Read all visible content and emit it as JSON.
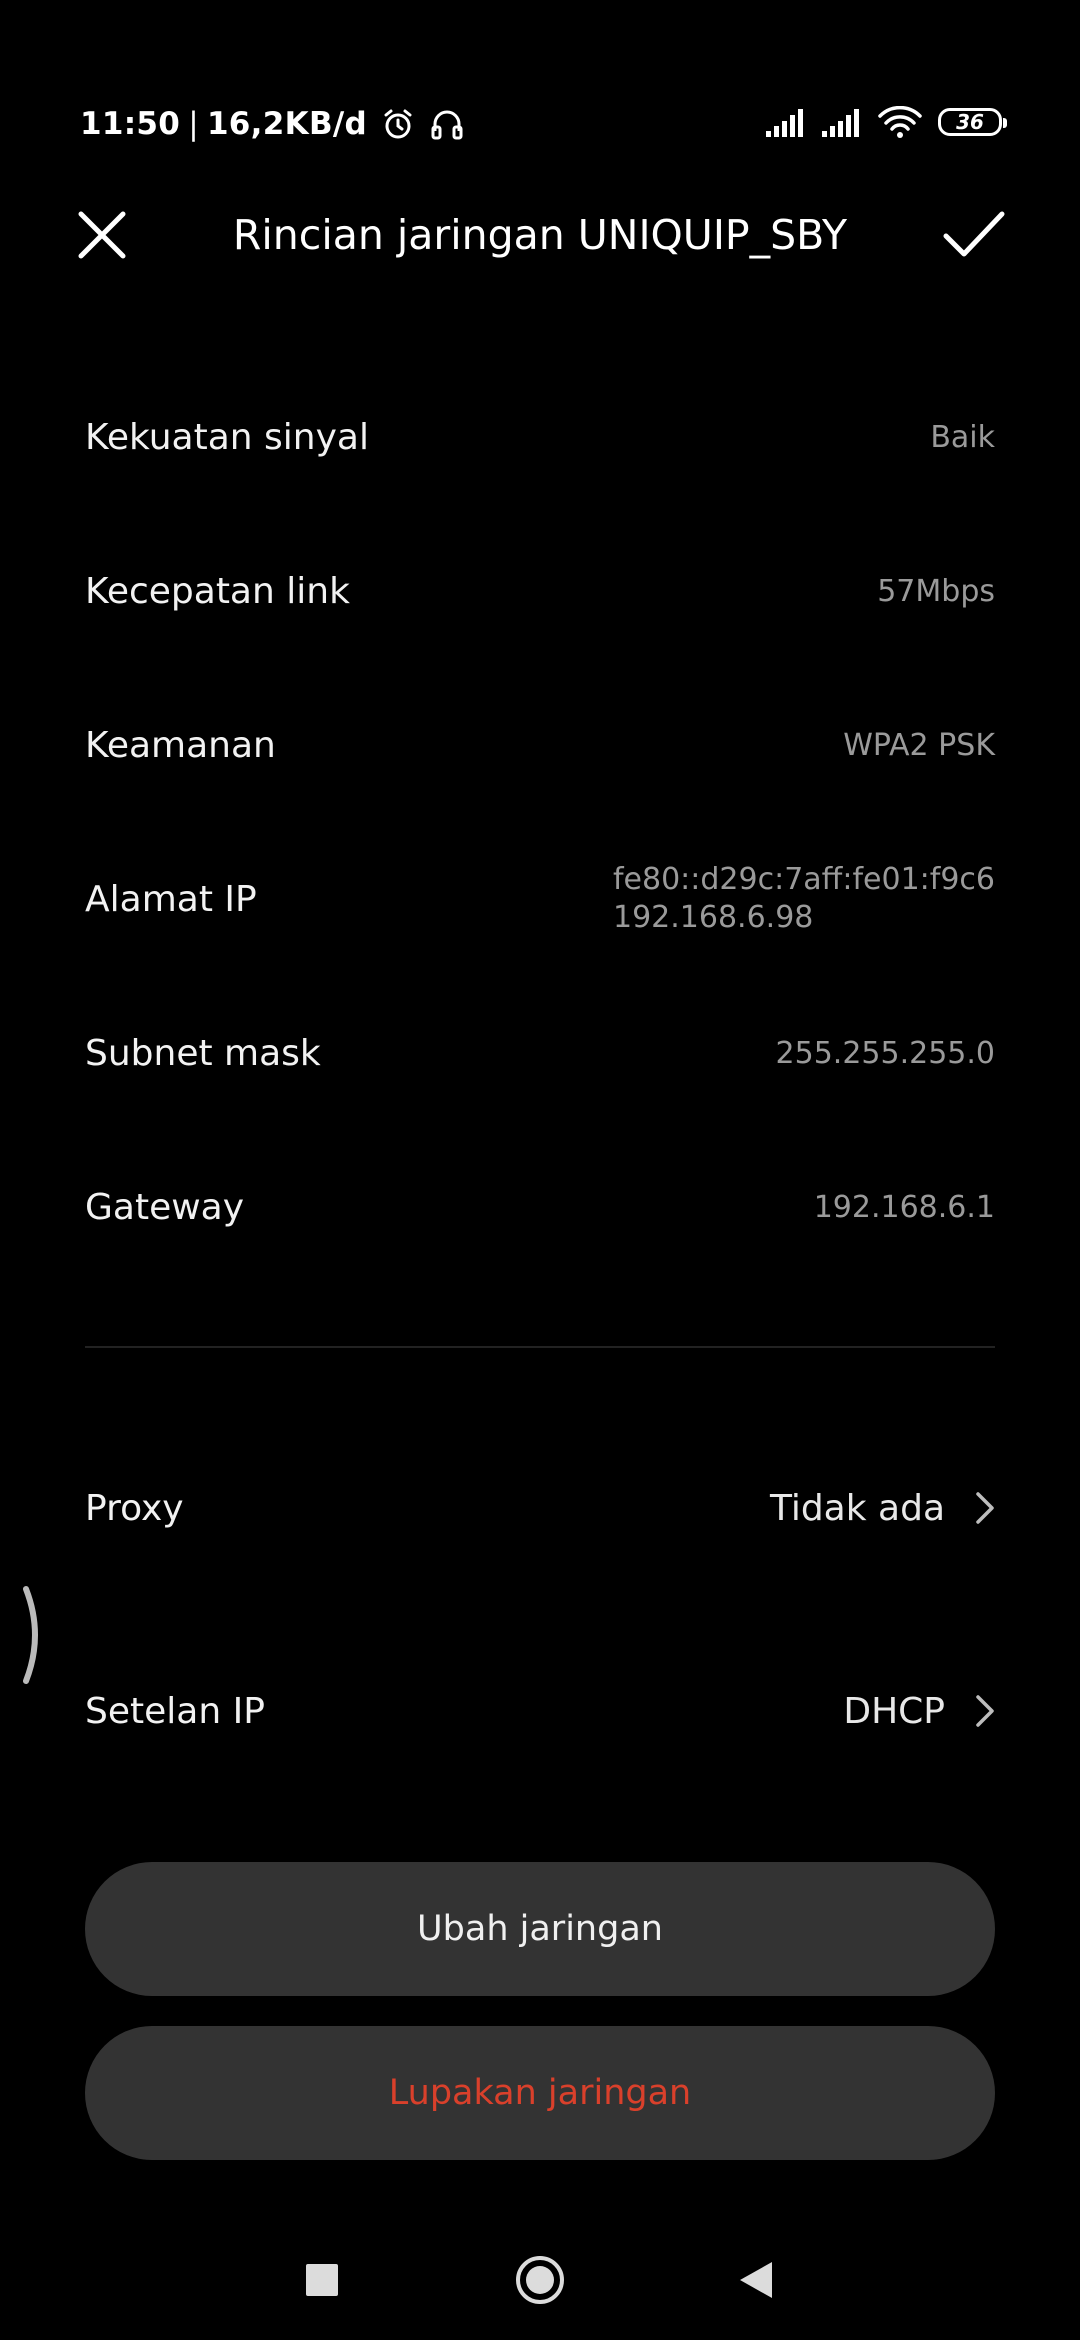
{
  "status_bar": {
    "time": "11:50",
    "separator": "|",
    "data_speed": "16,2KB/d",
    "battery_level": "36",
    "icons": [
      "alarm-icon",
      "headphones-icon",
      "cell-signal-1-icon",
      "cell-signal-2-icon",
      "wifi-icon",
      "battery-icon"
    ]
  },
  "header": {
    "title": "Rincian jaringan UNIQUIP_SBY",
    "close_icon": "close-icon",
    "confirm_icon": "check-icon"
  },
  "details": [
    {
      "label": "Kekuatan sinyal",
      "value": "Baik"
    },
    {
      "label": "Kecepatan link",
      "value": "57Mbps"
    },
    {
      "label": "Keamanan",
      "value": "WPA2 PSK"
    },
    {
      "label": "Alamat IP",
      "value_lines": [
        "fe80::d29c:7aff:fe01:f9c6",
        "192.168.6.98"
      ]
    },
    {
      "label": "Subnet mask",
      "value": "255.255.255.0"
    },
    {
      "label": "Gateway",
      "value": "192.168.6.1"
    }
  ],
  "settings": [
    {
      "label": "Proxy",
      "value": "Tidak ada",
      "icon": "chevron-right-icon"
    },
    {
      "label": "Setelan IP",
      "value": "DHCP",
      "icon": "chevron-right-icon"
    }
  ],
  "buttons": {
    "edit_label": "Ubah jaringan",
    "forget_label": "Lupakan jaringan"
  },
  "colors": {
    "background": "#000000",
    "button_bg": "#333333",
    "danger": "#d9402b",
    "secondary_text": "#9a9a9a"
  },
  "nav_bar": {
    "icons": [
      "recents-square-icon",
      "home-circle-icon",
      "back-triangle-icon"
    ]
  }
}
